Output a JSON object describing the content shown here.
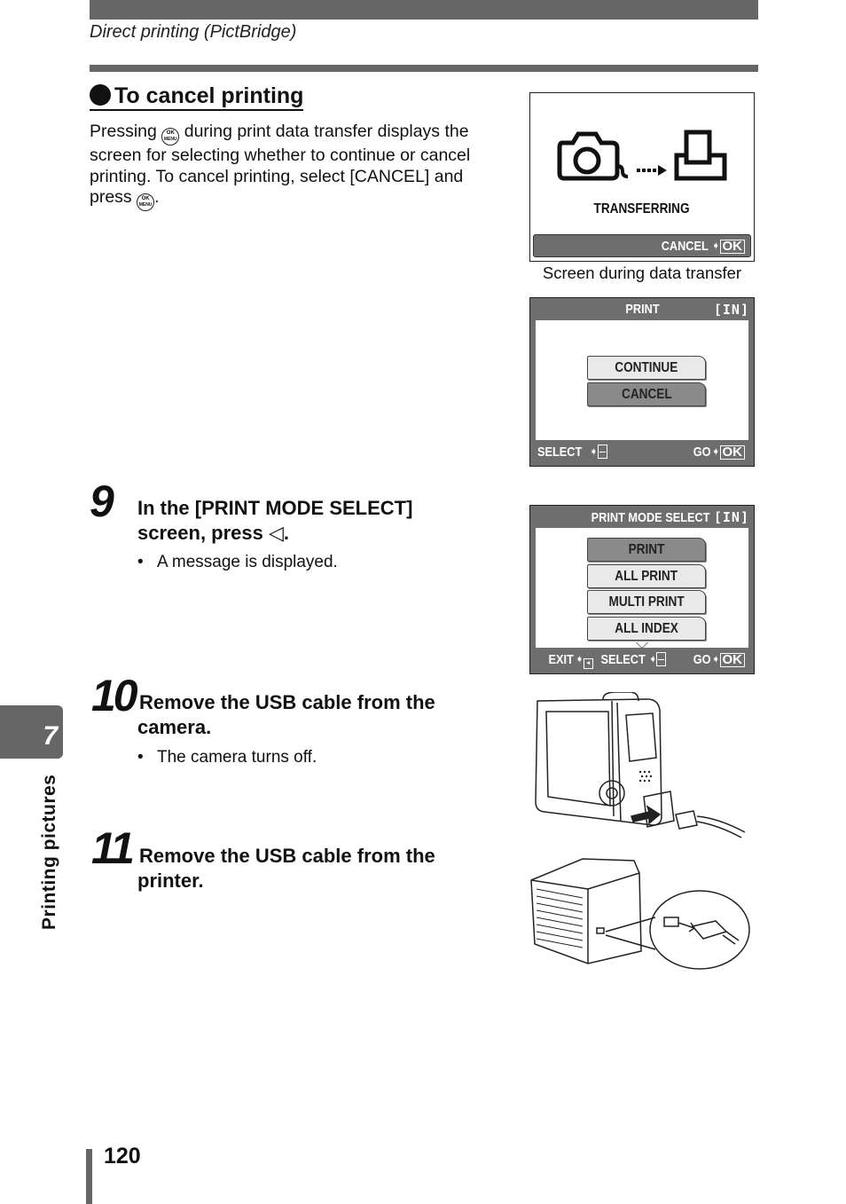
{
  "header": {
    "running_head": "Direct printing (PictBridge)"
  },
  "section": {
    "title": "To cancel printing",
    "intro_parts": [
      "Pressing",
      "during print data transfer displays the screen for selecting whether to continue or cancel printing. To cancel printing, select [CANCEL] and press",
      "."
    ],
    "ok_button_label_top": "OK",
    "ok_button_label_bottom": "MENU"
  },
  "screens": {
    "transfer": {
      "status": "TRANSFERRING",
      "footer_label": "CANCEL",
      "footer_key": "OK",
      "caption": "Screen during data transfer",
      "icons": [
        "camera-icon",
        "dotted-arrow-icon",
        "printer-icon"
      ]
    },
    "print_confirm": {
      "title": "PRINT",
      "memory": "[IN]",
      "options": [
        "CONTINUE",
        "CANCEL"
      ],
      "selected_index": 1,
      "footer_left": "SELECT",
      "footer_right": "GO",
      "footer_key": "OK"
    },
    "print_mode": {
      "title": "PRINT MODE SELECT",
      "memory": "[IN]",
      "options": [
        "PRINT",
        "ALL PRINT",
        "MULTI PRINT",
        "ALL INDEX"
      ],
      "selected_index": 0,
      "footer_exit": "EXIT",
      "footer_select": "SELECT",
      "footer_go": "GO",
      "footer_key": "OK"
    }
  },
  "steps": [
    {
      "number": "9",
      "title_line1": "In the [PRINT MODE SELECT]",
      "title_line2": "screen, press",
      "title_symbol": "◁",
      "title_end": ".",
      "note": "A message is displayed."
    },
    {
      "number": "10",
      "title_line1": "Remove the USB cable from the",
      "title_line2": "camera.",
      "note": "The camera turns off."
    },
    {
      "number": "11",
      "title_line1": "Remove the USB cable from the",
      "title_line2": "printer."
    }
  ],
  "illustrations": {
    "camera": "camera-usb-removal-illustration",
    "printer": "printer-usb-removal-illustration"
  },
  "sidebar": {
    "chapter_number": "7",
    "chapter_label": "Printing pictures"
  },
  "footer": {
    "page_number": "120"
  }
}
